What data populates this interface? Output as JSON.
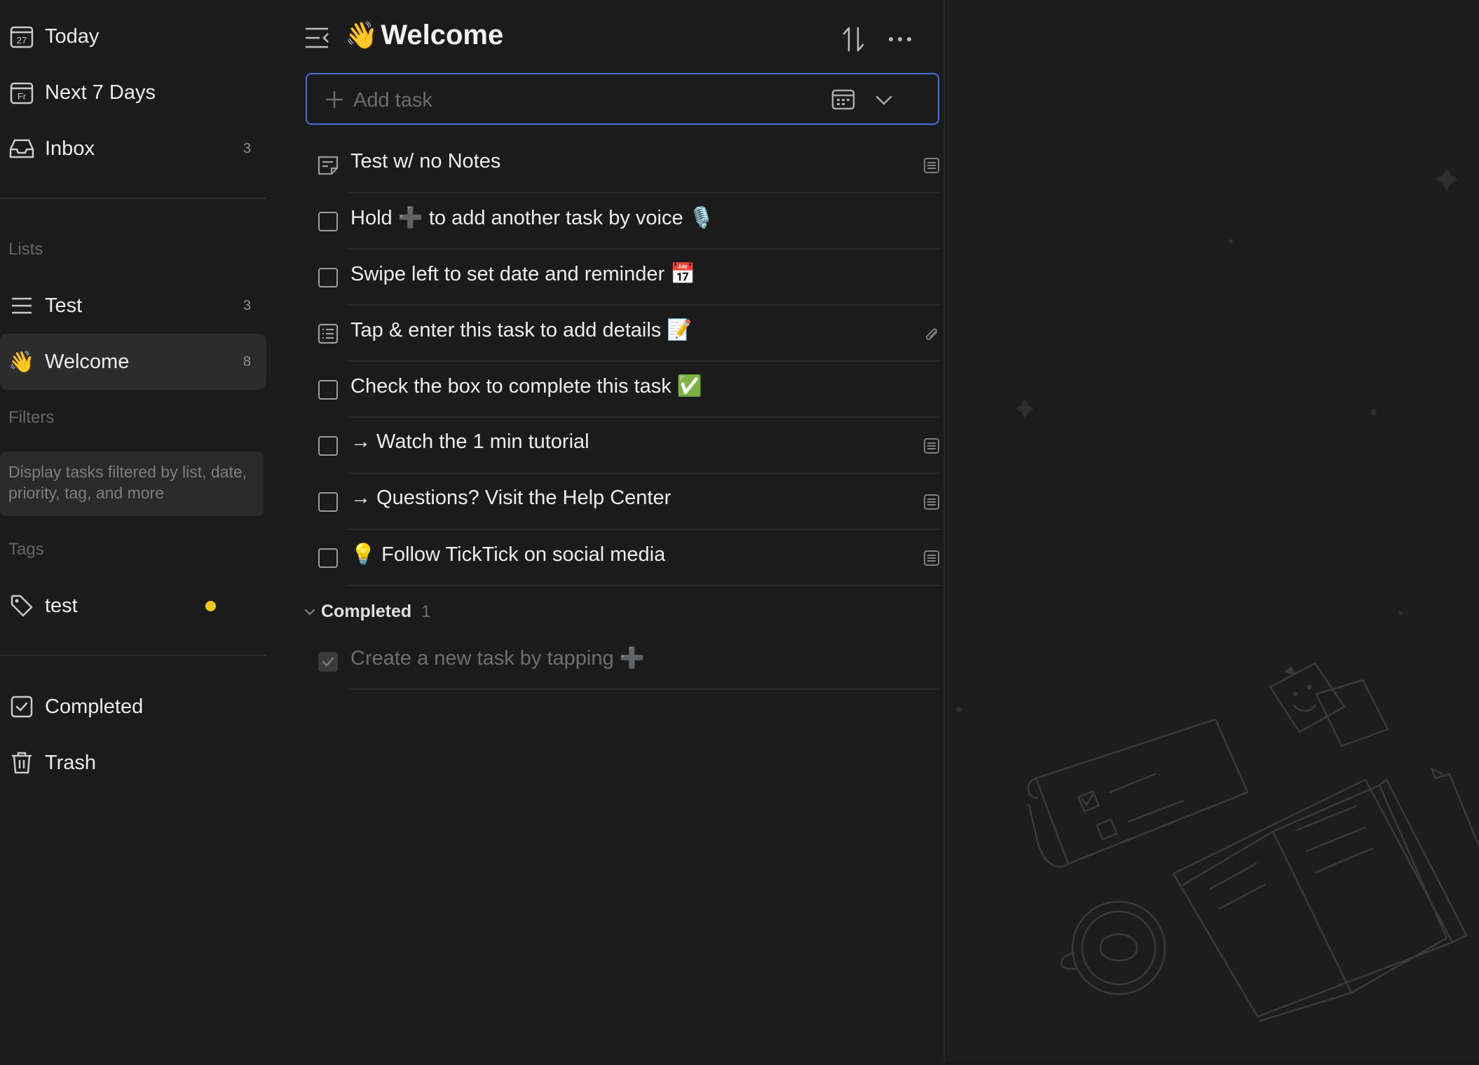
{
  "sidebar": {
    "smart_lists": [
      {
        "label": "Today",
        "icon": "calendar-today-icon",
        "date_text": "27",
        "count": ""
      },
      {
        "label": "Next 7 Days",
        "icon": "calendar-week-icon",
        "date_text": "Fr",
        "count": ""
      },
      {
        "label": "Inbox",
        "icon": "inbox-icon",
        "count": "3"
      }
    ],
    "lists_header": "Lists",
    "lists": [
      {
        "label": "Test",
        "icon": "list-icon",
        "count": "3"
      },
      {
        "label": "Welcome",
        "icon": "👋",
        "count": "8",
        "active": true
      }
    ],
    "filters_header": "Filters",
    "filters_hint": "Display tasks filtered by list, date, priority, tag, and more",
    "tags_header": "Tags",
    "tags": [
      {
        "label": "test",
        "icon": "tag-icon",
        "color": "#f3c623"
      }
    ],
    "bottom": [
      {
        "label": "Completed",
        "icon": "checkbox-checked-icon"
      },
      {
        "label": "Trash",
        "icon": "trash-icon"
      }
    ]
  },
  "main": {
    "title_emoji": "👋",
    "title": "Welcome",
    "add_task_placeholder": "Add task",
    "tasks": [
      {
        "title": "Test w/ no Notes",
        "kind": "note",
        "right_icon": "description-icon"
      },
      {
        "title": "Hold ➕ to add another task by voice 🎙️",
        "kind": "checkbox",
        "right_icon": ""
      },
      {
        "title": "Swipe left to set date and reminder 📅",
        "kind": "checkbox",
        "right_icon": ""
      },
      {
        "title": "Tap & enter this task to add details 📝",
        "kind": "checklist",
        "right_icon": "attachment-icon"
      },
      {
        "title": "Check the box to complete this task ✅",
        "kind": "checkbox",
        "right_icon": ""
      },
      {
        "title": "→ Watch the 1 min tutorial",
        "kind": "checkbox",
        "right_icon": "description-icon"
      },
      {
        "title": "→ Questions? Visit the Help Center",
        "kind": "checkbox",
        "right_icon": "description-icon"
      },
      {
        "title": "💡 Follow TickTick on social media",
        "kind": "checkbox",
        "right_icon": "description-icon"
      }
    ],
    "completed_label": "Completed",
    "completed_count": "1",
    "completed_tasks": [
      {
        "title": "Create a new task by tapping ➕"
      }
    ]
  },
  "colors": {
    "accent": "#4b6be0",
    "background": "#1b1b1b",
    "active_item": "#2c2c2c",
    "tag_yellow": "#f3c623"
  }
}
